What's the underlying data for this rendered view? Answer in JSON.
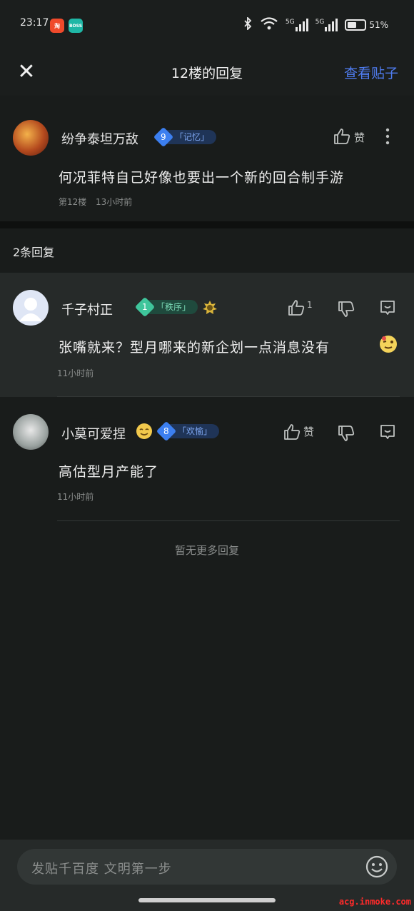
{
  "status_bar": {
    "time": "23:17",
    "app1_badge": "淘",
    "app2_badge": "BOSS",
    "net1": "5G",
    "net2": "5G",
    "battery": "51%"
  },
  "header": {
    "close_icon": "close-icon",
    "title": "12楼的回复",
    "view_post": "查看贴子"
  },
  "post": {
    "username": "纷争泰坦万敌",
    "level": "9",
    "level_tag": "「记忆」",
    "like_label": "赞",
    "content": "何况菲特自己好像也要出一个新的回合制手游",
    "floor": "第12楼",
    "time": "13小时前"
  },
  "reply_count": "2条回复",
  "replies": [
    {
      "username": "千子村正",
      "level": "1",
      "level_tag": "「秩序」",
      "like_count": "1",
      "content": "张嘴就来？型月哪来的新企划一点消息没有",
      "time": "11小时前"
    },
    {
      "username": "小莫可爱捏",
      "level": "8",
      "level_tag": "「欢愉」",
      "like_label": "赞",
      "content": "高估型月产能了",
      "time": "11小时前"
    }
  ],
  "no_more": "暂无更多回复",
  "input": {
    "placeholder": "发贴千百度 文明第一步"
  },
  "watermark": "acg.inmoke.com",
  "colors": {
    "accent": "#4f7cf0",
    "level_blue": "#3c7ff0",
    "level_green": "#3fc59b",
    "background": "#141716"
  }
}
